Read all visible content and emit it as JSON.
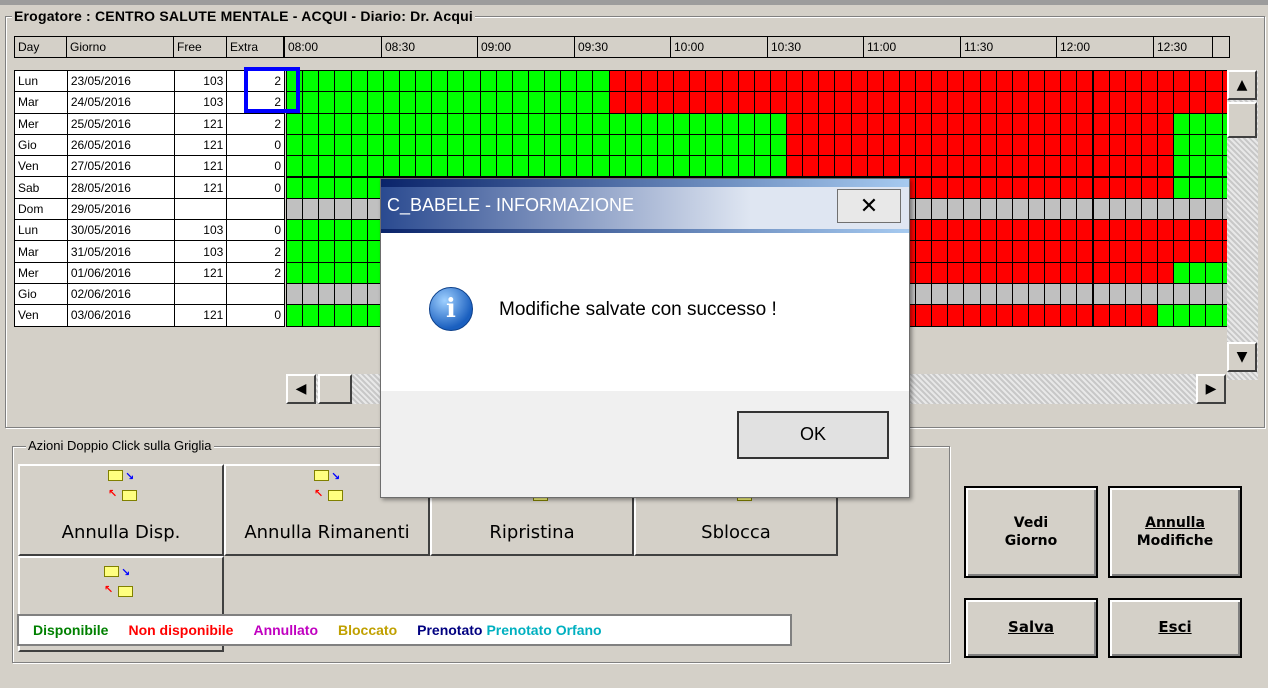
{
  "title": "Erogatore : CENTRO SALUTE MENTALE - ACQUI  -  Diario: Dr. Acqui",
  "columns": {
    "day": "Day",
    "giorno": "Giorno",
    "free": "Free",
    "extra": "Extra"
  },
  "times": [
    "08:00",
    "08:30",
    "09:00",
    "09:30",
    "10:00",
    "10:30",
    "11:00",
    "11:30",
    "12:00",
    "12:30"
  ],
  "rows": [
    {
      "day": "Lun",
      "date": "23/05/2016",
      "free": "103",
      "extra": "2"
    },
    {
      "day": "Mar",
      "date": "24/05/2016",
      "free": "103",
      "extra": "2"
    },
    {
      "day": "Mer",
      "date": "25/05/2016",
      "free": "121",
      "extra": "2"
    },
    {
      "day": "Gio",
      "date": "26/05/2016",
      "free": "121",
      "extra": "0"
    },
    {
      "day": "Ven",
      "date": "27/05/2016",
      "free": "121",
      "extra": "0"
    },
    {
      "day": "Sab",
      "date": "28/05/2016",
      "free": "121",
      "extra": "0"
    },
    {
      "day": "Dom",
      "date": "29/05/2016",
      "free": "",
      "extra": ""
    },
    {
      "day": "Lun",
      "date": "30/05/2016",
      "free": "103",
      "extra": "0"
    },
    {
      "day": "Mar",
      "date": "31/05/2016",
      "free": "103",
      "extra": "2"
    },
    {
      "day": "Mer",
      "date": "01/06/2016",
      "free": "121",
      "extra": "2"
    },
    {
      "day": "Gio",
      "date": "02/06/2016",
      "free": "",
      "extra": ""
    },
    {
      "day": "Ven",
      "date": "03/06/2016",
      "free": "121",
      "extra": "0"
    }
  ],
  "slot_states": {
    "legend_codes": {
      "G": "disponibile",
      "R": "non disponibile",
      "X": "vuoto"
    },
    "rows": [
      "GGGGGGGGGGGGGGGGGGGGRRRRRRRRRRRRRRRRRRRRRRRRRRRRRRRRRRRRRRR",
      "GGGGGGGGGGGGGGGGGGGGRRRRRRRRRRRRRRRRRRRRRRRRRRRRRRRRRRRRRRR",
      "GGGGGGGGGGGGGGGGGGGGGGGGGGGGGGGRRRRRRRRRRRRRRRRRRRRRRRRGGGG",
      "GGGGGGGGGGGGGGGGGGGGGGGGGGGGGGGRRRRRRRRRRRRRRRRRRRRRRRRGGGG",
      "GGGGGGGGGGGGGGGGGGGGGGGGGGGGGGGRRRRRRRRRRRRRRRRRRRRRRRRGGGG",
      "GGGGGGGGGGGGGGGGGGGGGGGGGGGGGGGRRRRRRRRRRRRRRRRRRRRRRRRGGGG",
      "XXXXXXXXXXXXXXXXXXXXXXXXXXXXXXXXXXXXXXXXXXXXXXXXXXXXXXXXXXX",
      "GGGGGGGGGGGGGGGGGGGGGGGGGGGGGGGRRRRRRRRRRRRRRRRRRRRRRRRRRRR",
      "GGGGGGGGGGGGGGGGGGGGGGGGGGGGGGGRRRRRRRRRRRRRRRRRRRRRRRRRRRR",
      "GGGGGGGGGGGGGGGGGGGGGGGGGGGGGGGRRRRRRRRRRRRRRRRRRRRRRRRGGGG",
      "XXXXXXXXXXXXXXXXXXXXXXXXXXXXXXXXXXXXXXXXXXXXXXXXXXXXXXXXXXX",
      "GGGGGGGGGGGGGGGGGGGGGGGGGGGGGGGRRRRRRRRRRRRRRRRRRRRRRRGGGGG"
    ]
  },
  "colors": {
    "green": "#00ff00",
    "red": "#ff0000",
    "grey": "#c0c0c0",
    "focus": "#0000ff"
  },
  "actions_group": {
    "title": "Azioni Doppio Click sulla Griglia",
    "buttons": [
      "Annulla Disp.",
      "Annulla Rimanenti",
      "Ripristina",
      "Sblocca"
    ]
  },
  "legend": [
    {
      "label": "Disponibile",
      "color": "#008000"
    },
    {
      "label": "Non disponibile",
      "color": "#ff0000"
    },
    {
      "label": "Annullato",
      "color": "#c000c0"
    },
    {
      "label": "Bloccato",
      "color": "#c0a000"
    },
    {
      "label": "Prenotato",
      "color": "#000080"
    },
    {
      "label": "Prenotato Orfano",
      "color": "#00b0c0"
    }
  ],
  "right_buttons": {
    "vedi_giorno": {
      "line1": "Vedi",
      "line2": "Giorno"
    },
    "annulla_modifiche": {
      "line1": "Annulla",
      "line2": "Modifiche"
    },
    "salva": "Salva",
    "esci": "Esci"
  },
  "dialog": {
    "title": "C_BABELE - INFORMAZIONE",
    "message": "Modifiche salvate con successo !",
    "ok": "OK",
    "icon": "info-icon"
  }
}
